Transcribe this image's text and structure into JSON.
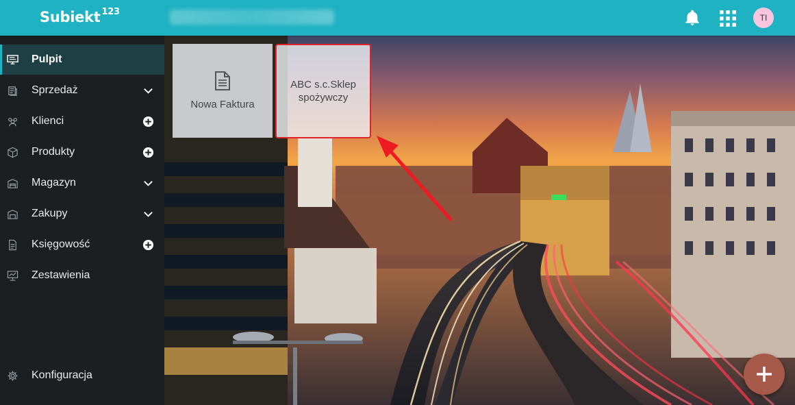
{
  "app": {
    "name": "Subiekt",
    "version": "123"
  },
  "header": {
    "user_initials": "TI"
  },
  "sidebar": {
    "items": [
      {
        "label": "Pulpit",
        "icon": "desktop-icon",
        "active": true,
        "right": ""
      },
      {
        "label": "Sprzedaż",
        "icon": "sales-icon",
        "right": "chevron"
      },
      {
        "label": "Klienci",
        "icon": "users-icon",
        "right": "plus"
      },
      {
        "label": "Produkty",
        "icon": "box-icon",
        "right": "plus"
      },
      {
        "label": "Magazyn",
        "icon": "warehouse-icon",
        "right": "chevron"
      },
      {
        "label": "Zakupy",
        "icon": "purchase-icon",
        "right": "chevron"
      },
      {
        "label": "Księgowość",
        "icon": "document-icon",
        "right": "plus"
      },
      {
        "label": "Zestawienia",
        "icon": "report-icon",
        "right": ""
      }
    ],
    "footer": {
      "label": "Konfiguracja",
      "icon": "gear-icon"
    }
  },
  "tiles": [
    {
      "label": "Nowa Faktura",
      "icon": "invoice-icon"
    },
    {
      "label": "ABC s.c.Sklep spożywczy",
      "highlighted": true
    }
  ],
  "colors": {
    "accent": "#1fb2c3",
    "sidebar": "#1b1f21",
    "active": "#1e3f44",
    "highlight": "#e0242a"
  }
}
